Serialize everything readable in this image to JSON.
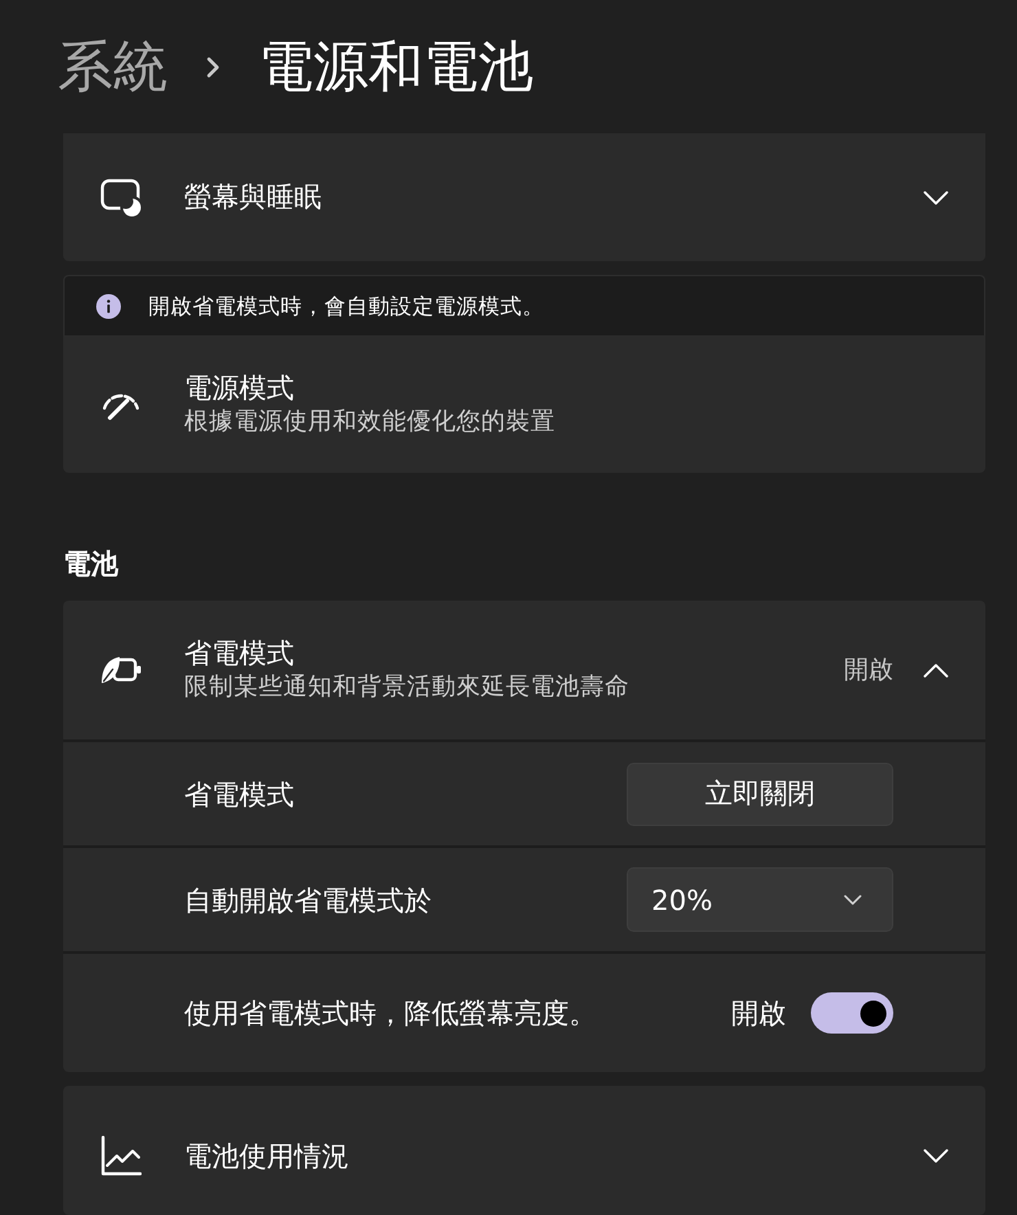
{
  "breadcrumb": [
    {
      "label": "系統",
      "current": false
    },
    {
      "label": "電源和電池",
      "current": true
    }
  ],
  "screen_and_sleep": {
    "title": "螢幕與睡眠",
    "expanded": false
  },
  "power_mode": {
    "notice": "開啟省電模式時，會自動設定電源模式。",
    "title": "電源模式",
    "description": "根據電源使用和效能優化您的裝置"
  },
  "battery_section": {
    "heading": "電池"
  },
  "battery_saver": {
    "title": "省電模式",
    "description": "限制某些通知和背景活動來延長電池壽命",
    "status": "開啟",
    "expanded": true,
    "settings": [
      {
        "kind": "button",
        "label": "省電模式",
        "button": "立即關閉"
      },
      {
        "kind": "dropdown",
        "label": "自動開啟省電模式於",
        "value": "20%"
      },
      {
        "kind": "toggle",
        "label": "使用省電模式時，降低螢幕亮度。",
        "state_text": "開啟",
        "on": true
      }
    ]
  },
  "battery_usage": {
    "title": "電池使用情況",
    "expanded": false
  }
}
